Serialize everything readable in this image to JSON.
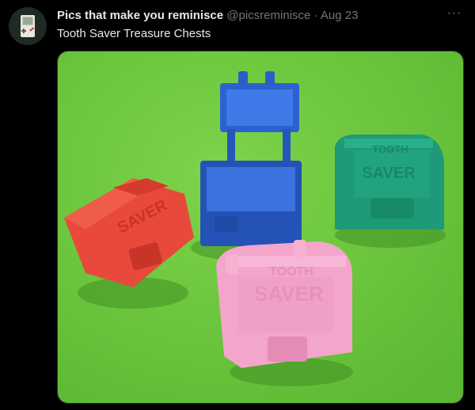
{
  "tweet": {
    "display_name": "Pics that make you reminisce",
    "handle": "@picsreminisce",
    "separator": "·",
    "date": "Aug 23",
    "text": "Tooth Saver Treasure Chests",
    "more_icon": "ellipsis-icon",
    "avatar_icon": "gameboy-icon"
  },
  "media": {
    "description_icon": "tooth-saver-chests-photo",
    "colors": {
      "background": "#6dc93c",
      "red": "#e8493a",
      "blue": "#2a5fc8",
      "teal": "#1f9a78",
      "pink": "#f0a0c8"
    }
  }
}
